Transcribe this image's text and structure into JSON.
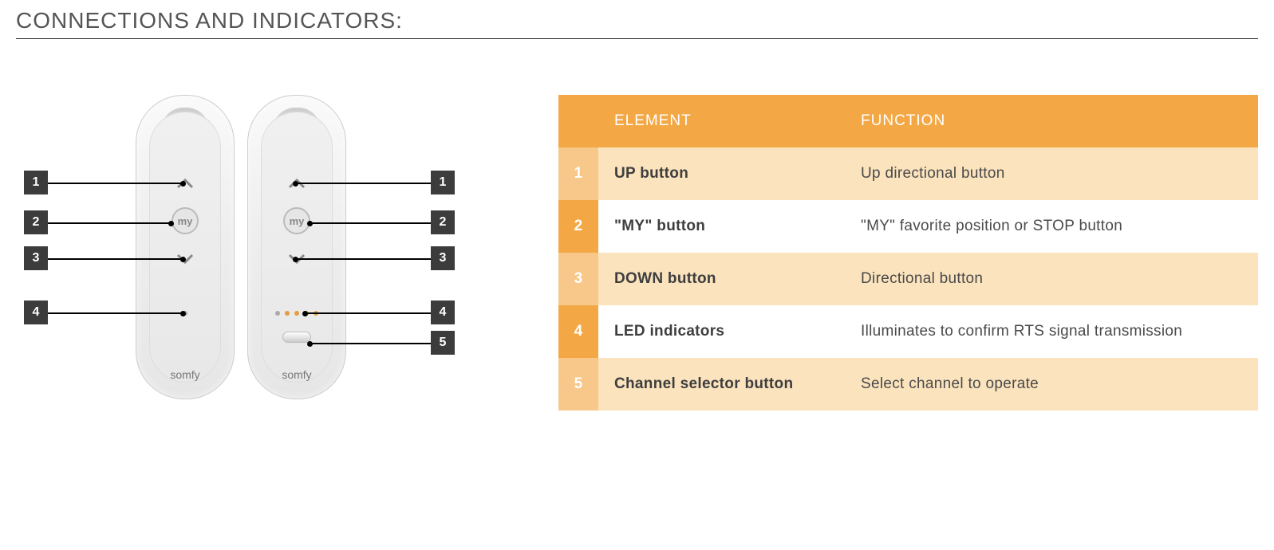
{
  "title": "CONNECTIONS AND INDICATORS:",
  "brand": "somfy",
  "myLabel": "my",
  "diagram": {
    "left": [
      "1",
      "2",
      "3",
      "4"
    ],
    "right": [
      "1",
      "2",
      "3",
      "4",
      "5"
    ]
  },
  "table": {
    "headers": {
      "num": "",
      "element": "ELEMENT",
      "function": "FUNCTION"
    },
    "rows": [
      {
        "num": "1",
        "element": "UP button",
        "function": "Up directional button"
      },
      {
        "num": "2",
        "element": "\"MY\" button",
        "function": "\"MY\" favorite position or STOP button"
      },
      {
        "num": "3",
        "element": "DOWN button",
        "function": "Directional button"
      },
      {
        "num": "4",
        "element": "LED indicators",
        "function": "Illuminates to confirm RTS signal transmission"
      },
      {
        "num": "5",
        "element": "Channel selector button",
        "function": "Select channel to operate"
      }
    ]
  }
}
